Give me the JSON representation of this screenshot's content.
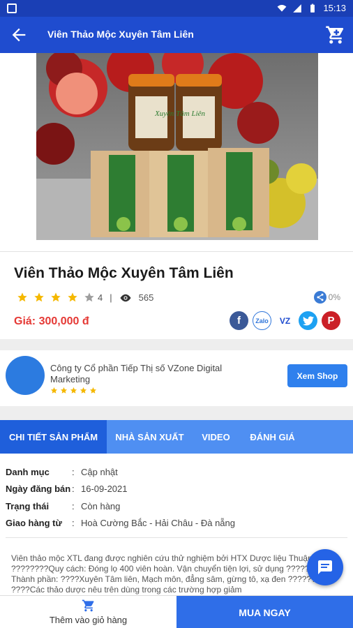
{
  "status_bar": {
    "time": "15:13"
  },
  "app_bar": {
    "title": "Viên Thảo Mộc Xuyên Tâm Liên"
  },
  "product_image_label": {
    "brand": "Xuyên Tâm Liên"
  },
  "product": {
    "name": "Viên Thảo Mộc Xuyên Tâm Liên",
    "rating": 4,
    "rating_text": "4",
    "views": "565",
    "share_percent": "0%",
    "price": "Giá: 300,000 đ"
  },
  "social": [
    "facebook-icon",
    "zalo-icon",
    "vz-icon",
    "twitter-icon",
    "pinterest-icon"
  ],
  "social_labels": {
    "zalo": "Zalo",
    "vz": "VZ"
  },
  "shop": {
    "name": "Công ty Cổ phần Tiếp Thị số VZone Digital Marketing",
    "rating": 5,
    "button": "Xem Shop"
  },
  "tabs": [
    {
      "label": "CHI TIẾT SẢN PHẨM",
      "active": true
    },
    {
      "label": "NHÀ SẢN XUẤT",
      "active": false
    },
    {
      "label": "VIDEO",
      "active": false
    },
    {
      "label": "ĐÁNH GIÁ",
      "active": false
    }
  ],
  "specs": [
    {
      "key": "Danh mục",
      "value": "Cập nhật"
    },
    {
      "key": "Ngày đăng bán",
      "value": "16-09-2021"
    },
    {
      "key": "Trạng thái",
      "value": "Còn hàng"
    },
    {
      "key": "Giao hàng từ",
      "value": "Hoà Cường Bắc - Hải Châu - Đà nẵng"
    }
  ],
  "description": "Viên thảo mộc XTL đang được nghiên cứu thử nghiệm bởi HTX Dược liệu Thuận. ????????Quy cách: Đóng lọ 400 viên hoàn. Vận chuyển tiện lợi, sử dụng ????????Thành phần: ????Xuyên Tâm liên, Mạch môn, đẳng sâm, gừng tô, xạ đen ???????? ????Các thảo dược nêu trên dùng trong các trường hợp giảm",
  "bottom": {
    "add_to_cart": "Thêm vào giỏ hàng",
    "buy_now": "MUA NGAY"
  },
  "colors": {
    "primary": "#1f4ccf",
    "accent": "#2f80ed",
    "price": "#e53935",
    "star": "#f5b800"
  }
}
